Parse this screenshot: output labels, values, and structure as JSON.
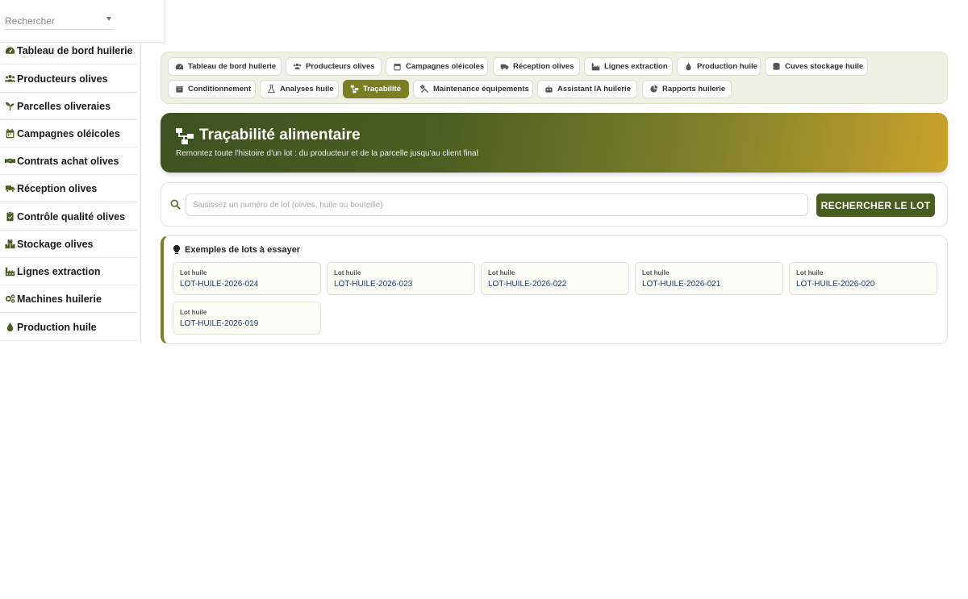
{
  "sidebar": {
    "search_placeholder": "Rechercher",
    "items": [
      {
        "label": "Tableau de bord huilerie",
        "icon": "gauge-icon"
      },
      {
        "label": "Producteurs olives",
        "icon": "users-icon"
      },
      {
        "label": "Parcelles oliveraies",
        "icon": "seedling-icon"
      },
      {
        "label": "Campagnes oléicoles",
        "icon": "calendar-icon"
      },
      {
        "label": "Contrats achat olives",
        "icon": "handshake-icon"
      },
      {
        "label": "Réception olives",
        "icon": "truck-icon"
      },
      {
        "label": "Contrôle qualité olives",
        "icon": "clipboard-check-icon"
      },
      {
        "label": "Stockage olives",
        "icon": "boxes-icon"
      },
      {
        "label": "Lignes extraction",
        "icon": "industry-icon"
      },
      {
        "label": "Machines huilerie",
        "icon": "cogs-icon"
      },
      {
        "label": "Production huile",
        "icon": "drop-icon"
      }
    ]
  },
  "nav": {
    "tabs": [
      {
        "label": "Tableau de bord huilerie",
        "icon": "gauge-icon"
      },
      {
        "label": "Producteurs olives",
        "icon": "users-icon"
      },
      {
        "label": "Campagnes oléicoles",
        "icon": "calendar-icon"
      },
      {
        "label": "Réception olives",
        "icon": "truck-icon"
      },
      {
        "label": "Lignes extraction",
        "icon": "industry-icon"
      },
      {
        "label": "Production huile",
        "icon": "drop-icon"
      },
      {
        "label": "Cuves stockage huile",
        "icon": "database-icon"
      },
      {
        "label": "Conditionnement",
        "icon": "box-icon"
      },
      {
        "label": "Analyses huile",
        "icon": "flask-icon"
      },
      {
        "label": "Traçabilité",
        "icon": "sitemap-icon",
        "active": true
      },
      {
        "label": "Maintenance équipements",
        "icon": "tools-icon"
      },
      {
        "label": "Assistant IA huilerie",
        "icon": "robot-icon"
      },
      {
        "label": "Rapports huilerie",
        "icon": "chart-pie-icon"
      }
    ]
  },
  "banner": {
    "title": "Traçabilité alimentaire",
    "subtitle": "Remontez toute l'histoire d'un lot : du producteur et de la parcelle jusqu'au client final"
  },
  "search": {
    "placeholder": "Saisissez un numéro de lot (olives, huile ou bouteille)",
    "value": "",
    "button_label": "RECHERCHER LE LOT"
  },
  "examples": {
    "title": "Exemples de lots à essayer",
    "lots": [
      {
        "kind": "Lot huile",
        "code": "LOT-HUILE-2026-024"
      },
      {
        "kind": "Lot huile",
        "code": "LOT-HUILE-2026-023"
      },
      {
        "kind": "Lot huile",
        "code": "LOT-HUILE-2026-022"
      },
      {
        "kind": "Lot huile",
        "code": "LOT-HUILE-2026-021"
      },
      {
        "kind": "Lot huile",
        "code": "LOT-HUILE-2026-020"
      },
      {
        "kind": "Lot huile",
        "code": "LOT-HUILE-2026-019"
      }
    ]
  },
  "colors": {
    "accent": "#7b7f24",
    "dark_green": "#4a5d20",
    "gold": "#c9a32a",
    "link": "#1f3a6b"
  }
}
